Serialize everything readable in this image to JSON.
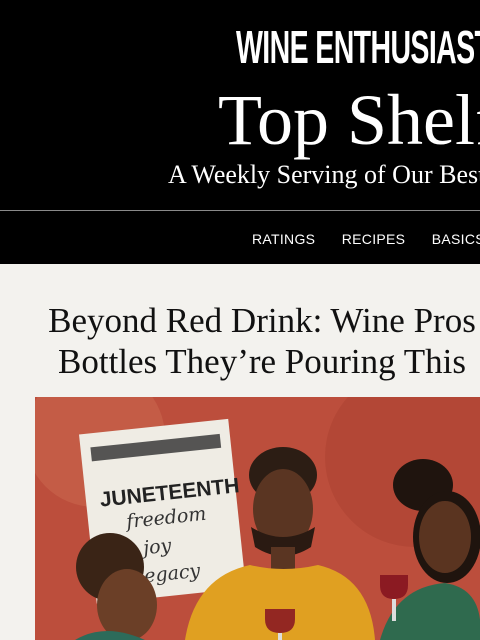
{
  "header": {
    "logo": "WINE ENTHUSIAST",
    "title": "Top Shelf",
    "subtitle": "A Weekly Serving of Our Best"
  },
  "nav": {
    "items": [
      "RATINGS",
      "RECIPES",
      "BASICS"
    ]
  },
  "article": {
    "headline_line1": "Beyond Red Drink: Wine Pros",
    "headline_line2": "Bottles They’re Pouring This"
  },
  "hero": {
    "sign_title": "JUNETEENTH",
    "sign_words": [
      "freedom",
      "joy",
      "legacy"
    ]
  },
  "colors": {
    "header_bg": "#000000",
    "page_bg": "#f3f2ee",
    "illustration_bg": "#c0553f"
  }
}
